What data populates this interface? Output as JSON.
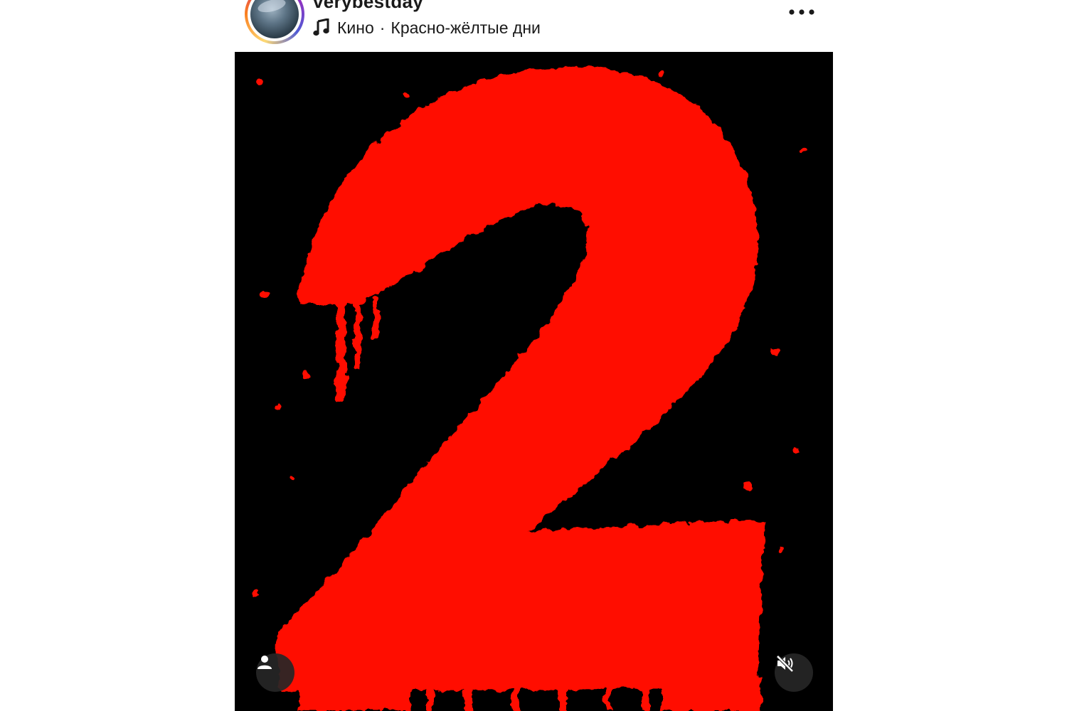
{
  "post": {
    "username": "verybestday",
    "audio": {
      "artist": "Кино",
      "separator": "·",
      "track": "Красно-жёлтые дни"
    }
  },
  "media": {
    "glyph": "2",
    "glyph_color": "#ff0a00",
    "background_color": "#000000"
  },
  "icons": {
    "more": "more-horizontal-icon",
    "music": "music-note-icon",
    "tags": "user-tag-icon",
    "mute": "speaker-muted-icon"
  }
}
